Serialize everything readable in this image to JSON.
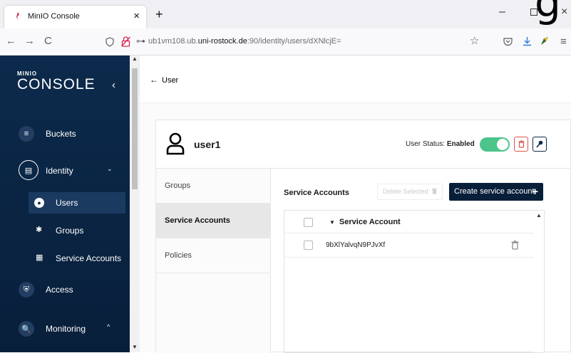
{
  "browser": {
    "tab_title": "MinIO Console",
    "tab_close": "×",
    "new_tab": "+",
    "url_host_prefix": "ub1vm108.ub.",
    "url_host_bold": "uni-rostock.de",
    "url_path": ":90/identity/users/dXNlcjE=",
    "window_min": "–",
    "window_close": "×",
    "overlay_char": "g",
    "nav_back": "←",
    "nav_forward": "→",
    "nav_reload": "C",
    "key_icon_char": "⊶",
    "star_char": "☆",
    "menu_char": "≡"
  },
  "sidebar": {
    "logo_small": "MINIO",
    "logo_big": "CONSOLE",
    "collapse_char": "‹",
    "items": [
      {
        "label": "Buckets",
        "icon": "≡"
      },
      {
        "label": "Identity",
        "icon": "▤",
        "arrow": "⌄"
      },
      {
        "label": "Access",
        "icon": "⛨"
      },
      {
        "label": "Monitoring",
        "icon": "🔍",
        "arrow": "^"
      }
    ],
    "sub_items": [
      {
        "label": "Users",
        "icon": "●"
      },
      {
        "label": "Groups",
        "icon": "✱"
      },
      {
        "label": "Service Accounts",
        "icon": "▦"
      }
    ]
  },
  "main": {
    "back_arrow": "←",
    "back_label": "User",
    "user_name": "user1",
    "status_label": "User Status:",
    "status_value": "Enabled",
    "status_enabled": true,
    "trash_char": "🗑",
    "key_char": "🔑",
    "tabs": [
      "Groups",
      "Service Accounts",
      "Policies"
    ],
    "active_tab": "Service Accounts",
    "panel_title": "Service Accounts",
    "delete_selected_label": "Delete Selected",
    "create_label": "Create service account",
    "create_plus": "+",
    "table_column": "Service Account",
    "caret_char": "▼",
    "rows": [
      "9bXlYalvqN9PJvXf"
    ]
  },
  "colors": {
    "sidebar_bg": "#0c2a4c",
    "accent_navy": "#081f3a",
    "toggle_on": "#4cc48a",
    "danger": "#e0534e"
  }
}
